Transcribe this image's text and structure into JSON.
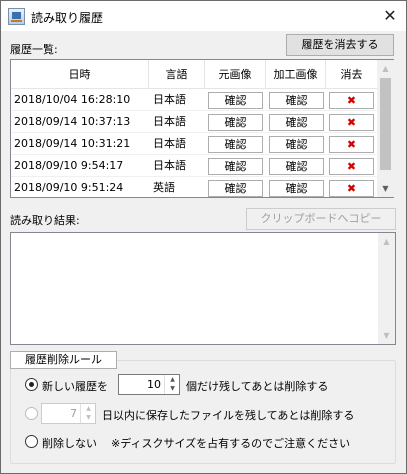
{
  "window": {
    "title": "読み取り履歴",
    "close_glyph": "✕"
  },
  "history": {
    "section_label": "履歴一覧:",
    "clear_button": "履歴を消去する",
    "columns": [
      "日時",
      "言語",
      "元画像",
      "加工画像",
      "消去"
    ],
    "rows": [
      {
        "datetime": "2018/10/04 16:28:10",
        "language": "日本語",
        "original": "確認",
        "processed": "確認",
        "delete": "✖"
      },
      {
        "datetime": "2018/09/14 10:37:13",
        "language": "日本語",
        "original": "確認",
        "processed": "確認",
        "delete": "✖"
      },
      {
        "datetime": "2018/09/14 10:31:21",
        "language": "日本語",
        "original": "確認",
        "processed": "確認",
        "delete": "✖"
      },
      {
        "datetime": "2018/09/10 9:54:17",
        "language": "日本語",
        "original": "確認",
        "processed": "確認",
        "delete": "✖"
      },
      {
        "datetime": "2018/09/10 9:51:24",
        "language": "英語",
        "original": "確認",
        "processed": "確認",
        "delete": "✖"
      }
    ]
  },
  "result": {
    "section_label": "読み取り結果:",
    "copy_button": "クリップボードへコピー",
    "text": ""
  },
  "rules": {
    "group_label": "履歴削除ルール",
    "option_keep_count": {
      "prefix": "新しい履歴を",
      "value": "10",
      "suffix": "個だけ残してあとは削除する",
      "selected": true
    },
    "option_keep_days": {
      "value": "7",
      "suffix": "日以内に保存したファイルを残してあとは削除する",
      "selected": false
    },
    "option_never": {
      "label": "削除しない",
      "note": "※ディスクサイズを占有するのでご注意ください",
      "selected": false
    }
  }
}
